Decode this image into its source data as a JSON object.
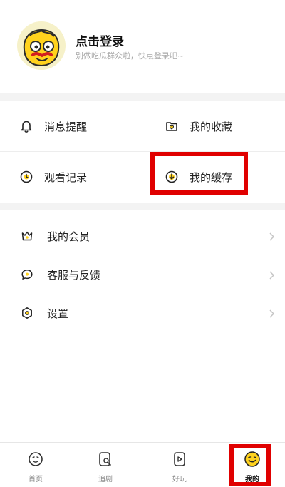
{
  "profile": {
    "title": "点击登录",
    "subtitle": "别做吃瓜群众啦，快点登录吧~"
  },
  "grid": {
    "items": [
      {
        "label": "消息提醒",
        "icon": "bell-icon"
      },
      {
        "label": "我的收藏",
        "icon": "heart-folder-icon"
      },
      {
        "label": "观看记录",
        "icon": "clock-icon"
      },
      {
        "label": "我的缓存",
        "icon": "download-icon"
      }
    ]
  },
  "menu": {
    "items": [
      {
        "label": "我的会员",
        "icon": "crown-icon"
      },
      {
        "label": "客服与反馈",
        "icon": "chat-icon"
      },
      {
        "label": "设置",
        "icon": "gear-icon"
      }
    ]
  },
  "tabbar": {
    "items": [
      {
        "label": "首页",
        "icon": "home-face-icon"
      },
      {
        "label": "追剧",
        "icon": "search-doc-icon"
      },
      {
        "label": "好玩",
        "icon": "play-card-icon"
      },
      {
        "label": "我的",
        "icon": "smiley-icon",
        "active": true
      }
    ]
  },
  "colors": {
    "accent_yellow": "#ffd21e",
    "highlight_red": "#e00000",
    "text_primary": "#222222",
    "text_muted": "#a9a9a9"
  }
}
